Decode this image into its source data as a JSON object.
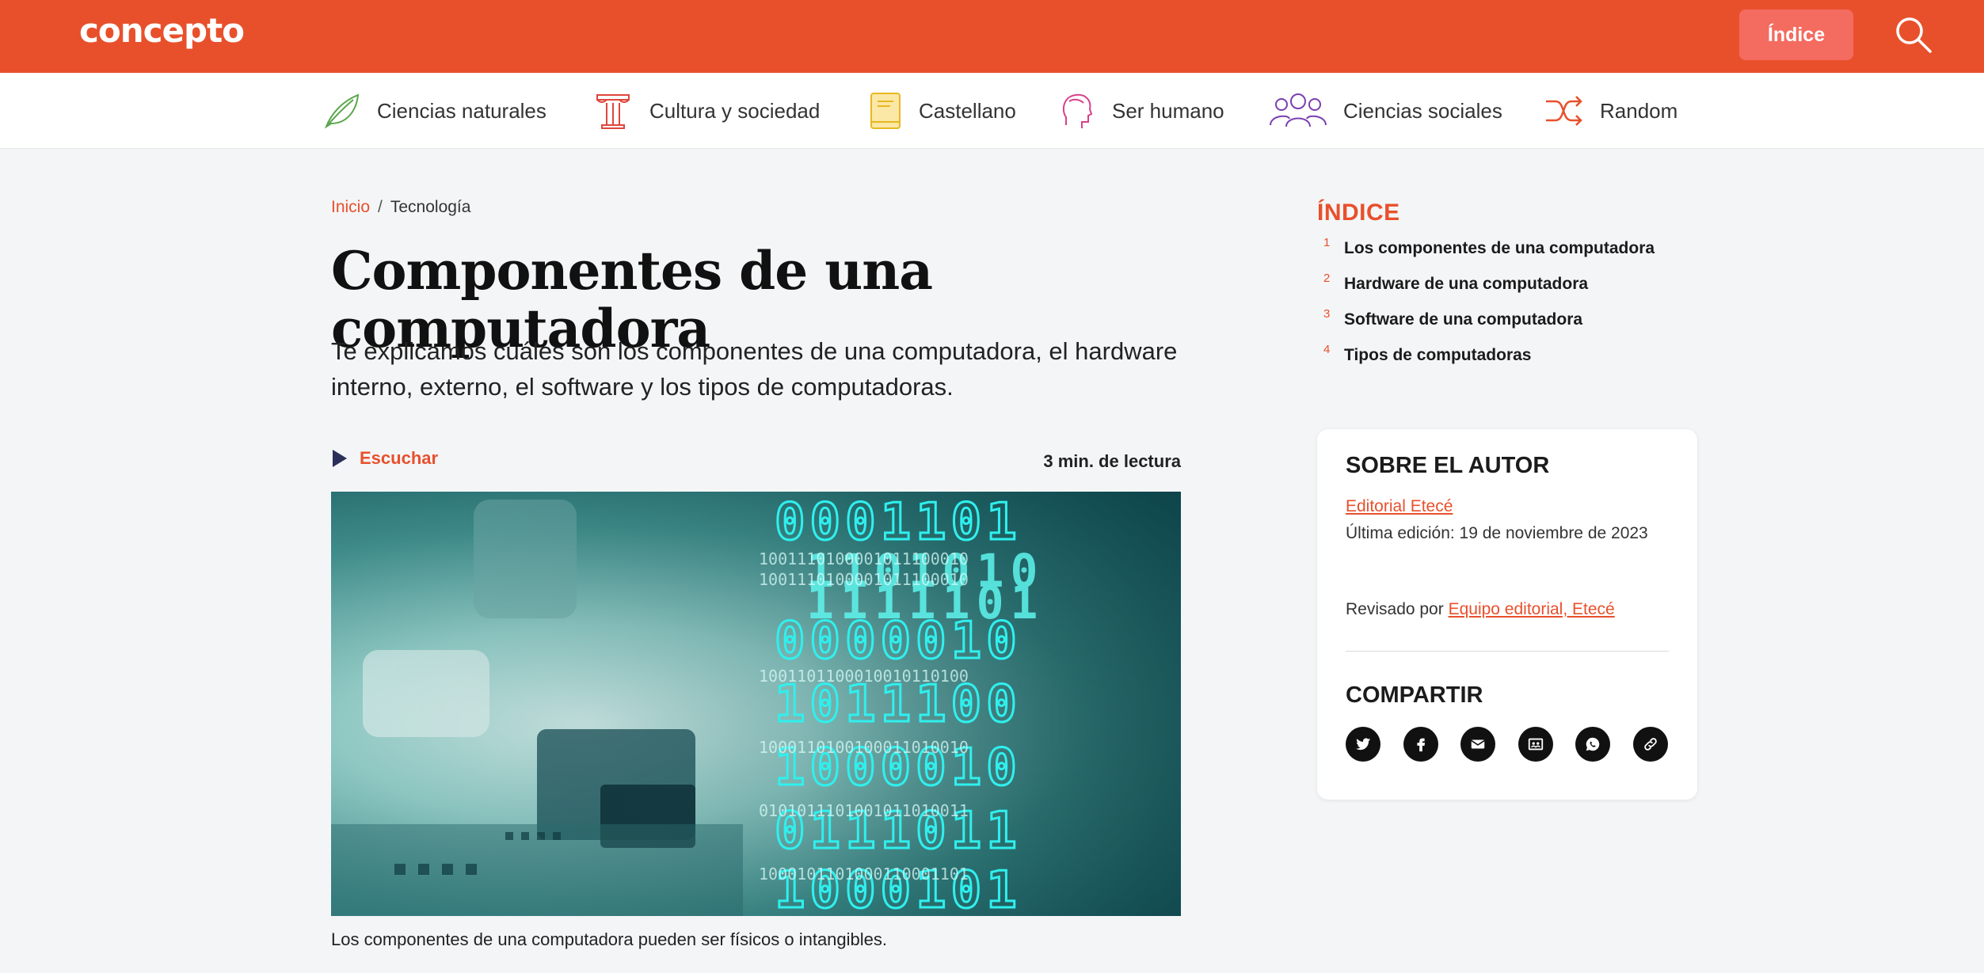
{
  "header": {
    "logo": "concepto",
    "index_button": "Índice",
    "brand_color": "#e8502c"
  },
  "categories": [
    {
      "label": "Ciencias naturales",
      "icon": "leaf-icon",
      "color": "#5aa64c"
    },
    {
      "label": "Cultura y sociedad",
      "icon": "column-icon",
      "color": "#e0463c"
    },
    {
      "label": "Castellano",
      "icon": "book-icon",
      "color": "#e8b820"
    },
    {
      "label": "Ser humano",
      "icon": "head-icon",
      "color": "#d8408a"
    },
    {
      "label": "Ciencias sociales",
      "icon": "people-icon",
      "color": "#7b3fb0"
    },
    {
      "label": "Random",
      "icon": "shuffle-icon",
      "color": "#e8502c"
    }
  ],
  "breadcrumb": {
    "home": "Inicio",
    "separator": "/",
    "current": "Tecnología"
  },
  "article": {
    "title": "Componentes de una computadora",
    "subtitle": "Te explicamos cuáles son los componentes de una computadora, el hardware interno, externo, el software y los tipos de computadoras.",
    "listen": "Escuchar",
    "read_time": "3 min. de lectura",
    "image_caption": "Los componentes de una computadora pueden ser físicos o intangibles."
  },
  "index": {
    "title": "ÍNDICE",
    "items": [
      {
        "num": "1",
        "label": "Los componentes de una computadora"
      },
      {
        "num": "2",
        "label": "Hardware de una computadora"
      },
      {
        "num": "3",
        "label": "Software de una computadora"
      },
      {
        "num": "4",
        "label": "Tipos de computadoras"
      }
    ]
  },
  "author": {
    "heading": "SOBRE EL AUTOR",
    "name": "Editorial Etecé",
    "last_edit": "Última edición: 19 de noviembre de 2023",
    "reviewed_prefix": "Revisado por",
    "reviewed_by": "Equipo editorial, Etecé"
  },
  "share": {
    "heading": "COMPARTIR",
    "buttons": [
      "twitter-icon",
      "facebook-icon",
      "email-icon",
      "classroom-icon",
      "whatsapp-icon",
      "link-icon"
    ]
  }
}
